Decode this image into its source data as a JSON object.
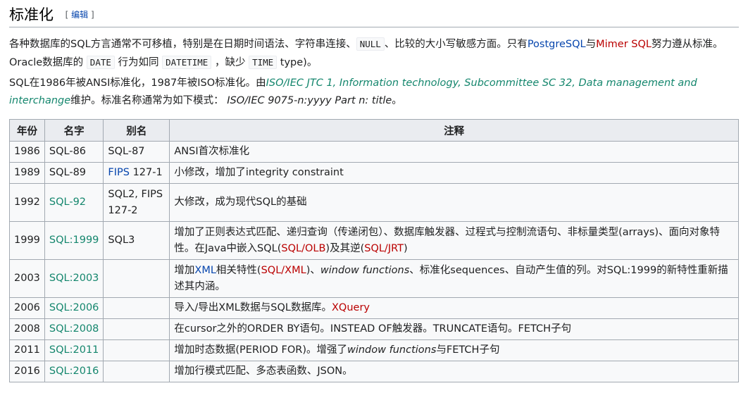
{
  "heading": {
    "title": "标准化",
    "edit_open": "[ ",
    "edit_label": "编辑",
    "edit_close": " ]"
  },
  "p1": {
    "t1": "各种数据库的SQL方言通常不可移植，特别是在日期时间语法、字符串连接、",
    "code_null": "NULL",
    "t2": "、比较的大小写敏感方面。只有",
    "link_postgres": "PostgreSQL",
    "t3": "与",
    "link_mimer": "Mimer SQL",
    "t4": "努力遵从标准。Oracle数据库的",
    "code_date": "DATE",
    "t5": "行为如同",
    "code_datetime": "DATETIME",
    "t6": "，缺少",
    "code_time": "TIME",
    "t7": "type)。"
  },
  "p2": {
    "t1": "SQL在1986年被ANSI标准化，1987年被ISO标准化。由",
    "link_iso": "ISO/IEC JTC 1, Information technology, Subcommittee SC 32, Data management and interchange",
    "t2": "维护。标准名称通常为如下模式：",
    "pattern": "ISO/IEC 9075-n:yyyy Part n: title",
    "t3": "。"
  },
  "table": {
    "headers": [
      "年份",
      "名字",
      "别名",
      "注释"
    ],
    "rows": [
      {
        "year": "1986",
        "name": "SQL-86",
        "alias": "SQL-87",
        "note": "ANSI首次标准化"
      },
      {
        "year": "1989",
        "name": "SQL-89",
        "alias_link": "FIPS",
        "alias_rest": " 127-1",
        "note": "小修改，增加了integrity constraint"
      },
      {
        "year": "1992",
        "name": "SQL-92",
        "alias": "SQL2, FIPS 127-2",
        "note": "大修改，成为现代SQL的基础"
      },
      {
        "year": "1999",
        "name": "SQL:1999",
        "alias": "SQL3",
        "note1": "增加了正则表达式匹配、递归查询（传递闭包）、数据库触发器、过程式与控制流语句、非标量类型(arrays)、面向对象特性。在Java中嵌入SQL(",
        "link_olb": "SQL/OLB",
        "note2": ")及其逆(",
        "link_jrt": "SQL/JRT",
        "note3": ")"
      },
      {
        "year": "2003",
        "name": "SQL:2003",
        "alias": "",
        "note1": "增加",
        "link_xml": "XML",
        "note2": "相关特性(",
        "link_sqlxml": "SQL/XML",
        "note3": ")、",
        "italic": "window functions",
        "note4": "、标准化sequences、自动产生值的列。对SQL:1999的新特性重新描述其内涵。"
      },
      {
        "year": "2006",
        "name": "SQL:2006",
        "alias": "",
        "note1": "导入/导出XML数据与SQL数据库。",
        "link_xquery": "XQuery"
      },
      {
        "year": "2008",
        "name": "SQL:2008",
        "alias": "",
        "note": "在cursor之外的ORDER BY语句。INSTEAD OF触发器。TRUNCATE语句。FETCH子句"
      },
      {
        "year": "2011",
        "name": "SQL:2011",
        "alias": "",
        "note1": "增加时态数据(PERIOD FOR)。增强了",
        "italic": "window functions",
        "note2": "与FETCH子句"
      },
      {
        "year": "2016",
        "name": "SQL:2016",
        "alias": "",
        "note": "增加行模式匹配、多态表函数、JSON。"
      }
    ]
  }
}
